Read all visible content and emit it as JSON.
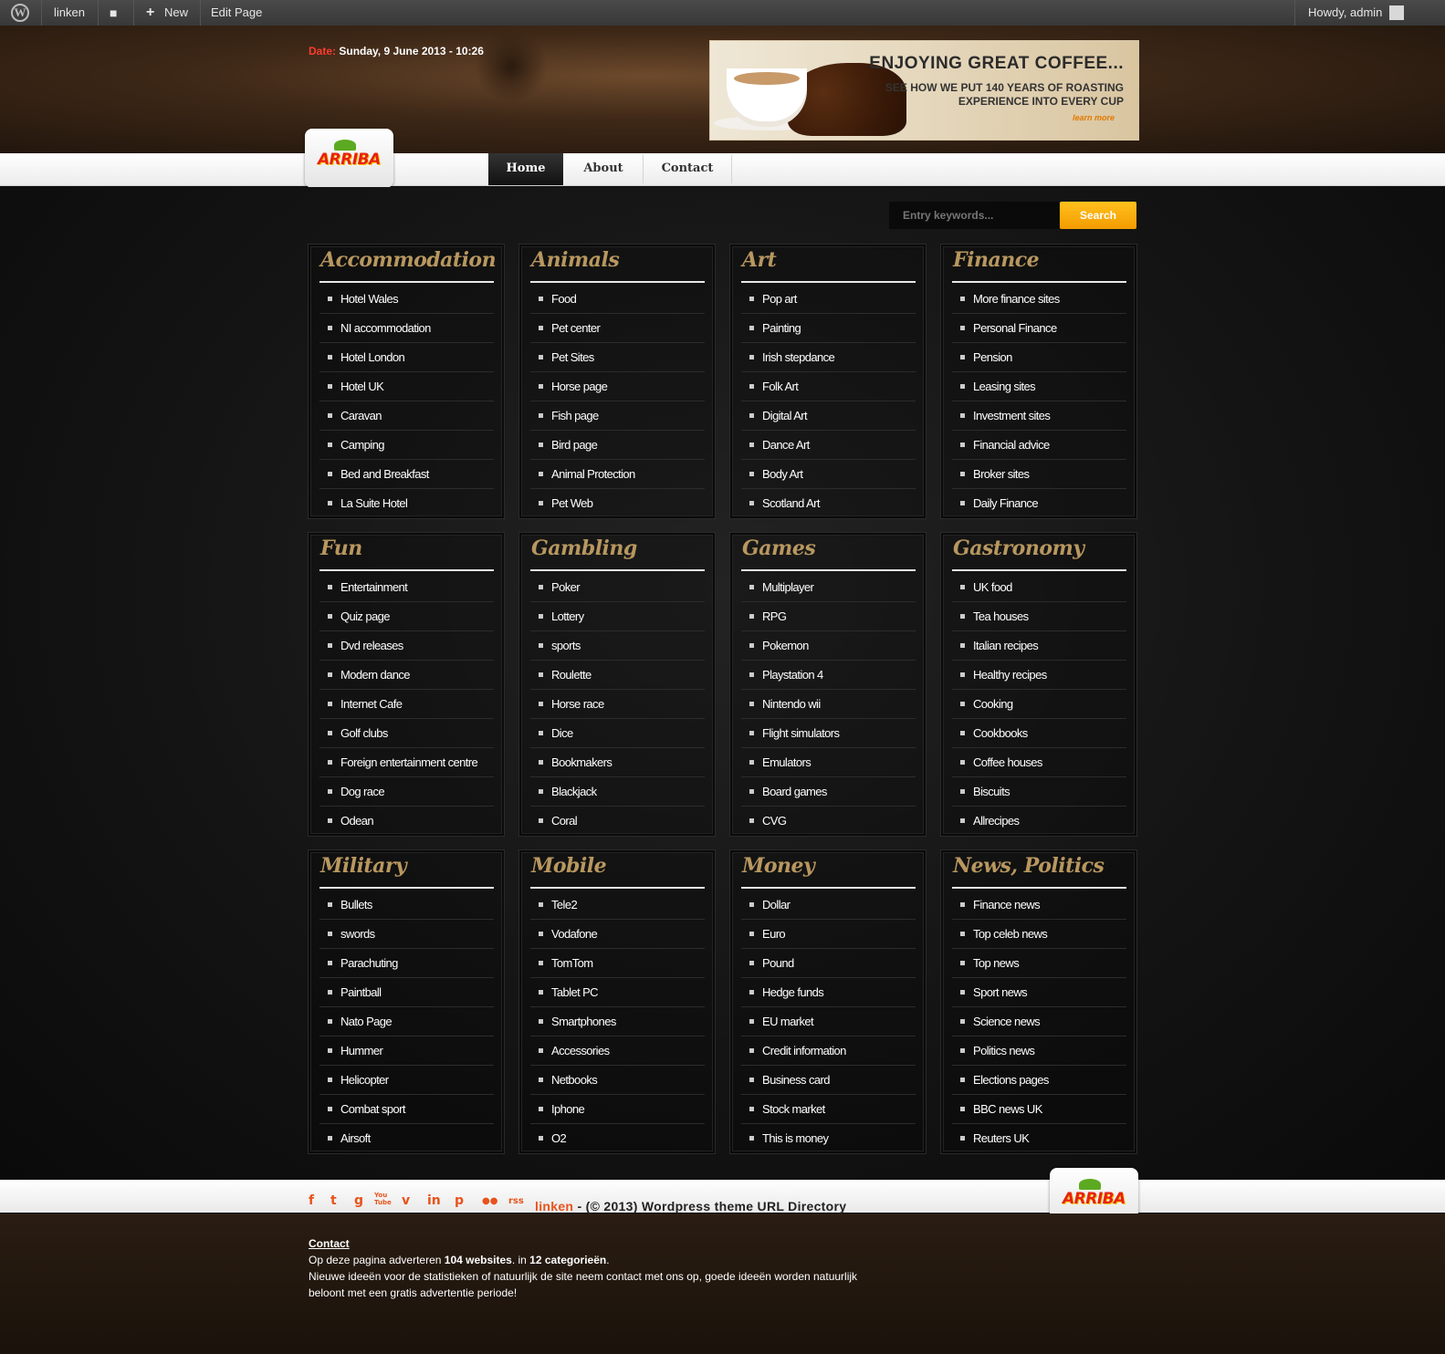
{
  "adminbar": {
    "site_name": "linken",
    "new_label": "New",
    "edit_label": "Edit Page",
    "howdy": "Howdy, admin"
  },
  "header": {
    "date_label": "Date:",
    "date_value": "Sunday, 9 June 2013 - 10:26"
  },
  "banner": {
    "title": "ENJOYING GREAT COFFEE...",
    "line1": "SEE HOW WE PUT 140 YEARS OF ROASTING",
    "line2": "EXPERIENCE INTO EVERY CUP",
    "cta": "learn more"
  },
  "logo_text": "ARRIBA",
  "nav": {
    "items": [
      "Home",
      "About",
      "Contact"
    ]
  },
  "search": {
    "placeholder": "Entry keywords...",
    "button": "Search"
  },
  "categories": [
    {
      "title": "Accommodation",
      "items": [
        "Hotel Wales",
        "NI accommodation",
        "Hotel London",
        "Hotel UK",
        "Caravan",
        "Camping",
        "Bed and Breakfast",
        "La Suite Hotel"
      ]
    },
    {
      "title": "Animals",
      "items": [
        "Food",
        "Pet center",
        "Pet Sites",
        "Horse page",
        "Fish page",
        "Bird page",
        "Animal Protection",
        "Pet Web"
      ]
    },
    {
      "title": "Art",
      "items": [
        "Pop art",
        "Painting",
        "Irish stepdance",
        "Folk Art",
        "Digital Art",
        "Dance Art",
        "Body Art",
        "Scotland Art"
      ]
    },
    {
      "title": "Finance",
      "items": [
        "More finance sites",
        "Personal Finance",
        "Pension",
        "Leasing sites",
        "Investment sites",
        "Financial advice",
        "Broker sites",
        "Daily Finance"
      ]
    },
    {
      "title": "Fun",
      "items": [
        "Entertainment",
        "Quiz page",
        "Dvd releases",
        "Modern dance",
        "Internet Cafe",
        "Golf clubs",
        "Foreign entertainment centre",
        "Dog race",
        "Odean"
      ]
    },
    {
      "title": "Gambling",
      "items": [
        "Poker",
        "Lottery",
        "sports",
        "Roulette",
        "Horse race",
        "Dice",
        "Bookmakers",
        "Blackjack",
        "Coral"
      ]
    },
    {
      "title": "Games",
      "items": [
        "Multiplayer",
        "RPG",
        "Pokemon",
        "Playstation 4",
        "Nintendo wii",
        "Flight simulators",
        "Emulators",
        "Board games",
        "CVG"
      ]
    },
    {
      "title": "Gastronomy",
      "items": [
        "UK food",
        "Tea houses",
        "Italian recipes",
        "Healthy recipes",
        "Cooking",
        "Cookbooks",
        "Coffee houses",
        "Biscuits",
        "Allrecipes"
      ]
    },
    {
      "title": "Military",
      "items": [
        "Bullets",
        "swords",
        "Parachuting",
        "Paintball",
        "Nato Page",
        "Hummer",
        "Helicopter",
        "Combat sport",
        "Airsoft"
      ]
    },
    {
      "title": "Mobile",
      "items": [
        "Tele2",
        "Vodafone",
        "TomTom",
        "Tablet PC",
        "Smartphones",
        "Accessories",
        "Netbooks",
        "Iphone",
        "O2"
      ]
    },
    {
      "title": "Money",
      "items": [
        "Dollar",
        "Euro",
        "Pound",
        "Hedge funds",
        "EU market",
        "Credit information",
        "Business card",
        "Stock market",
        "This is money"
      ]
    },
    {
      "title": "News, Politics",
      "items": [
        "Finance news",
        "Top celeb news",
        "Top news",
        "Sport news",
        "Science news",
        "Politics news",
        "Elections pages",
        "BBC news UK",
        "Reuters UK"
      ]
    }
  ],
  "footer": {
    "social": [
      "f",
      "t",
      "g",
      "You Tube",
      "v",
      "in",
      "p",
      "●●",
      "rss"
    ],
    "site": "linken",
    "copyright": " - (© 2013) Wordpress theme URL Directory",
    "contact": "Contact",
    "line1_a": "Op deze pagina adverteren ",
    "line1_b": "104 websites",
    "line1_c": ". in ",
    "line1_d": "12 categorieën",
    "line1_e": ".",
    "line2": "Nieuwe ideeën voor de statistieken of natuurlijk de site neem contact met ons op, goede ideeën worden natuurlijk beloont met een gratis advertentie periode!"
  },
  "colors": {
    "accent_orange": "#f49b00",
    "date_red": "#ff3b2f",
    "heading_gold": "#b8975f",
    "link_orange": "#e8531c"
  }
}
